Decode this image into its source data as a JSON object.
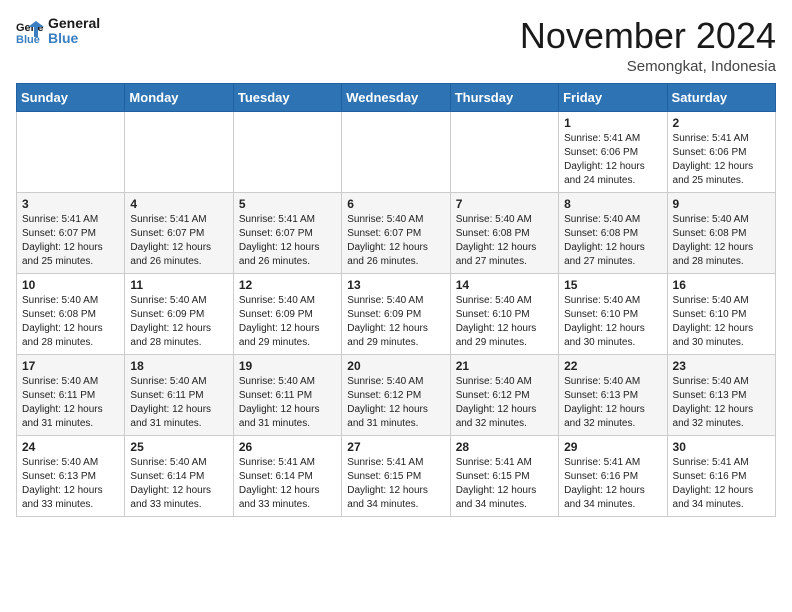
{
  "logo": {
    "line1": "General",
    "line2": "Blue"
  },
  "title": "November 2024",
  "location": "Semongkat, Indonesia",
  "days_header": [
    "Sunday",
    "Monday",
    "Tuesday",
    "Wednesday",
    "Thursday",
    "Friday",
    "Saturday"
  ],
  "weeks": [
    [
      {
        "day": "",
        "info": ""
      },
      {
        "day": "",
        "info": ""
      },
      {
        "day": "",
        "info": ""
      },
      {
        "day": "",
        "info": ""
      },
      {
        "day": "",
        "info": ""
      },
      {
        "day": "1",
        "info": "Sunrise: 5:41 AM\nSunset: 6:06 PM\nDaylight: 12 hours and 24 minutes."
      },
      {
        "day": "2",
        "info": "Sunrise: 5:41 AM\nSunset: 6:06 PM\nDaylight: 12 hours and 25 minutes."
      }
    ],
    [
      {
        "day": "3",
        "info": "Sunrise: 5:41 AM\nSunset: 6:07 PM\nDaylight: 12 hours and 25 minutes."
      },
      {
        "day": "4",
        "info": "Sunrise: 5:41 AM\nSunset: 6:07 PM\nDaylight: 12 hours and 26 minutes."
      },
      {
        "day": "5",
        "info": "Sunrise: 5:41 AM\nSunset: 6:07 PM\nDaylight: 12 hours and 26 minutes."
      },
      {
        "day": "6",
        "info": "Sunrise: 5:40 AM\nSunset: 6:07 PM\nDaylight: 12 hours and 26 minutes."
      },
      {
        "day": "7",
        "info": "Sunrise: 5:40 AM\nSunset: 6:08 PM\nDaylight: 12 hours and 27 minutes."
      },
      {
        "day": "8",
        "info": "Sunrise: 5:40 AM\nSunset: 6:08 PM\nDaylight: 12 hours and 27 minutes."
      },
      {
        "day": "9",
        "info": "Sunrise: 5:40 AM\nSunset: 6:08 PM\nDaylight: 12 hours and 28 minutes."
      }
    ],
    [
      {
        "day": "10",
        "info": "Sunrise: 5:40 AM\nSunset: 6:08 PM\nDaylight: 12 hours and 28 minutes."
      },
      {
        "day": "11",
        "info": "Sunrise: 5:40 AM\nSunset: 6:09 PM\nDaylight: 12 hours and 28 minutes."
      },
      {
        "day": "12",
        "info": "Sunrise: 5:40 AM\nSunset: 6:09 PM\nDaylight: 12 hours and 29 minutes."
      },
      {
        "day": "13",
        "info": "Sunrise: 5:40 AM\nSunset: 6:09 PM\nDaylight: 12 hours and 29 minutes."
      },
      {
        "day": "14",
        "info": "Sunrise: 5:40 AM\nSunset: 6:10 PM\nDaylight: 12 hours and 29 minutes."
      },
      {
        "day": "15",
        "info": "Sunrise: 5:40 AM\nSunset: 6:10 PM\nDaylight: 12 hours and 30 minutes."
      },
      {
        "day": "16",
        "info": "Sunrise: 5:40 AM\nSunset: 6:10 PM\nDaylight: 12 hours and 30 minutes."
      }
    ],
    [
      {
        "day": "17",
        "info": "Sunrise: 5:40 AM\nSunset: 6:11 PM\nDaylight: 12 hours and 31 minutes."
      },
      {
        "day": "18",
        "info": "Sunrise: 5:40 AM\nSunset: 6:11 PM\nDaylight: 12 hours and 31 minutes."
      },
      {
        "day": "19",
        "info": "Sunrise: 5:40 AM\nSunset: 6:11 PM\nDaylight: 12 hours and 31 minutes."
      },
      {
        "day": "20",
        "info": "Sunrise: 5:40 AM\nSunset: 6:12 PM\nDaylight: 12 hours and 31 minutes."
      },
      {
        "day": "21",
        "info": "Sunrise: 5:40 AM\nSunset: 6:12 PM\nDaylight: 12 hours and 32 minutes."
      },
      {
        "day": "22",
        "info": "Sunrise: 5:40 AM\nSunset: 6:13 PM\nDaylight: 12 hours and 32 minutes."
      },
      {
        "day": "23",
        "info": "Sunrise: 5:40 AM\nSunset: 6:13 PM\nDaylight: 12 hours and 32 minutes."
      }
    ],
    [
      {
        "day": "24",
        "info": "Sunrise: 5:40 AM\nSunset: 6:13 PM\nDaylight: 12 hours and 33 minutes."
      },
      {
        "day": "25",
        "info": "Sunrise: 5:40 AM\nSunset: 6:14 PM\nDaylight: 12 hours and 33 minutes."
      },
      {
        "day": "26",
        "info": "Sunrise: 5:41 AM\nSunset: 6:14 PM\nDaylight: 12 hours and 33 minutes."
      },
      {
        "day": "27",
        "info": "Sunrise: 5:41 AM\nSunset: 6:15 PM\nDaylight: 12 hours and 34 minutes."
      },
      {
        "day": "28",
        "info": "Sunrise: 5:41 AM\nSunset: 6:15 PM\nDaylight: 12 hours and 34 minutes."
      },
      {
        "day": "29",
        "info": "Sunrise: 5:41 AM\nSunset: 6:16 PM\nDaylight: 12 hours and 34 minutes."
      },
      {
        "day": "30",
        "info": "Sunrise: 5:41 AM\nSunset: 6:16 PM\nDaylight: 12 hours and 34 minutes."
      }
    ]
  ]
}
